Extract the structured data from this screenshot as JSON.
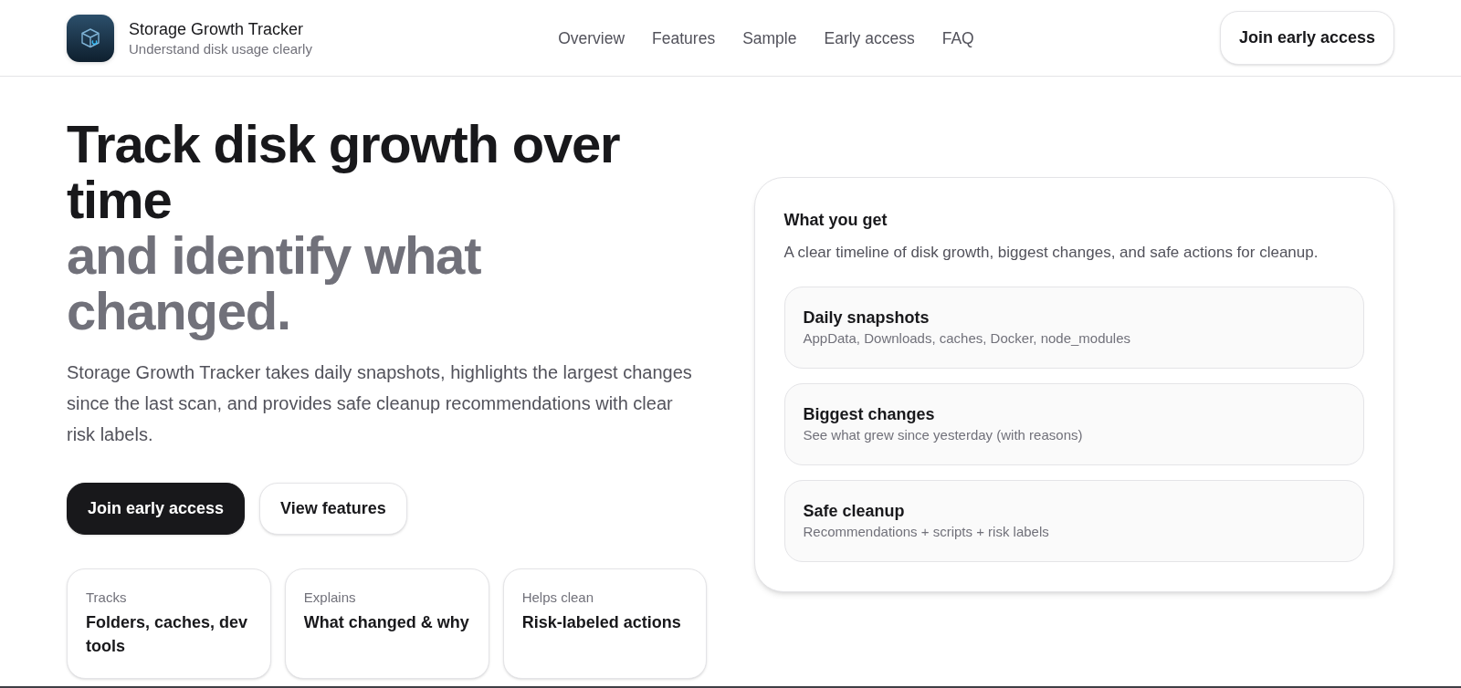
{
  "brand": {
    "title": "Storage Growth Tracker",
    "tagline": "Understand disk usage clearly"
  },
  "nav": {
    "links": [
      "Overview",
      "Features",
      "Sample",
      "Early access",
      "FAQ"
    ],
    "cta": "Join early access"
  },
  "hero": {
    "headline": "Track disk growth over time",
    "headline_muted": "and identify what changed.",
    "description": "Storage Growth Tracker takes daily snapshots, highlights the largest changes since the last scan, and provides safe cleanup recommendations with clear risk labels.",
    "buttons": [
      {
        "label": "Join early access",
        "kind": "primary"
      },
      {
        "label": "View features",
        "kind": "secondary"
      }
    ],
    "stats": [
      {
        "label": "Tracks",
        "value": "Folders, caches, dev tools"
      },
      {
        "label": "Explains",
        "value": "What changed & why"
      },
      {
        "label": "Helps clean",
        "value": "Risk-labeled actions"
      }
    ]
  },
  "summary_card": {
    "title": "What you get",
    "description": "A clear timeline of disk growth, biggest changes, and safe actions for cleanup.",
    "items": [
      {
        "title": "Daily snapshots",
        "description": "AppData, Downloads, caches, Docker, node_modules"
      },
      {
        "title": "Biggest changes",
        "description": "See what grew since yesterday (with reasons)"
      },
      {
        "title": "Safe cleanup",
        "description": "Recommendations + scripts + risk labels"
      }
    ]
  }
}
